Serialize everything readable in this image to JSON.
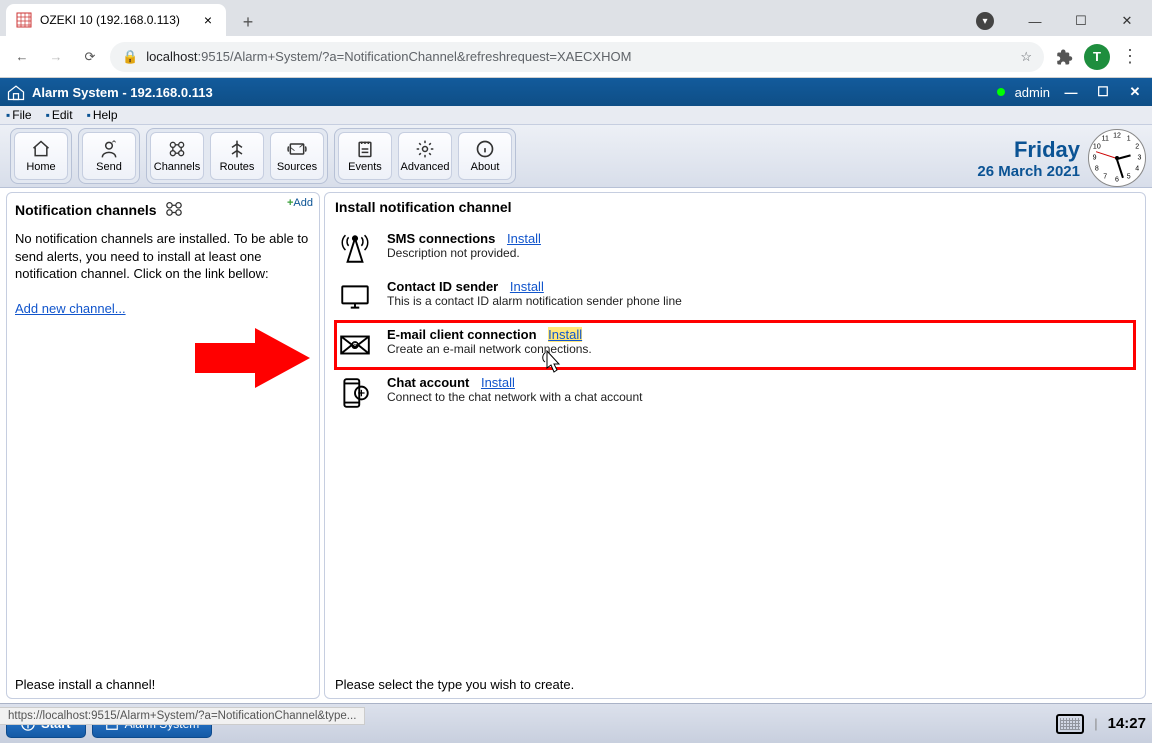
{
  "browser": {
    "tab_title": "OZEKI 10 (192.168.0.113)",
    "url_host": "localhost",
    "url_path": ":9515/Alarm+System/?a=NotificationChannel&refreshrequest=XAECXHOM",
    "avatar_letter": "T"
  },
  "app_header": {
    "title": "Alarm System - 192.168.0.113",
    "user": "admin"
  },
  "menu": {
    "file": "File",
    "edit": "Edit",
    "help": "Help"
  },
  "toolbar": {
    "home": "Home",
    "send": "Send",
    "channels": "Channels",
    "routes": "Routes",
    "sources": "Sources",
    "events": "Events",
    "advanced": "Advanced",
    "about": "About"
  },
  "date": {
    "day": "Friday",
    "full": "26 March 2021"
  },
  "sidebar": {
    "title": "Notification channels",
    "add": "Add",
    "body": "No notification channels are installed. To be able to send alerts, you need to install at least one notification channel. Click on the link bellow:",
    "add_link": "Add new channel...",
    "footer": "Please install a channel!"
  },
  "main": {
    "title": "Install notification channel",
    "channels": [
      {
        "name": "SMS connections",
        "install": "Install",
        "desc": "Description not provided."
      },
      {
        "name": "Contact ID sender",
        "install": "Install",
        "desc": "This is a contact ID alarm notification sender phone line"
      },
      {
        "name": "E-mail client connection",
        "install": "Install",
        "desc": "Create an e-mail network connections."
      },
      {
        "name": "Chat account",
        "install": "Install",
        "desc": "Connect to the chat network with a chat account"
      }
    ],
    "footer": "Please select the type you wish to create."
  },
  "taskbar": {
    "start": "Start",
    "task1": "Alarm System",
    "time": "14:27"
  },
  "status_url": "https://localhost:9515/Alarm+System/?a=NotificationChannel&type..."
}
